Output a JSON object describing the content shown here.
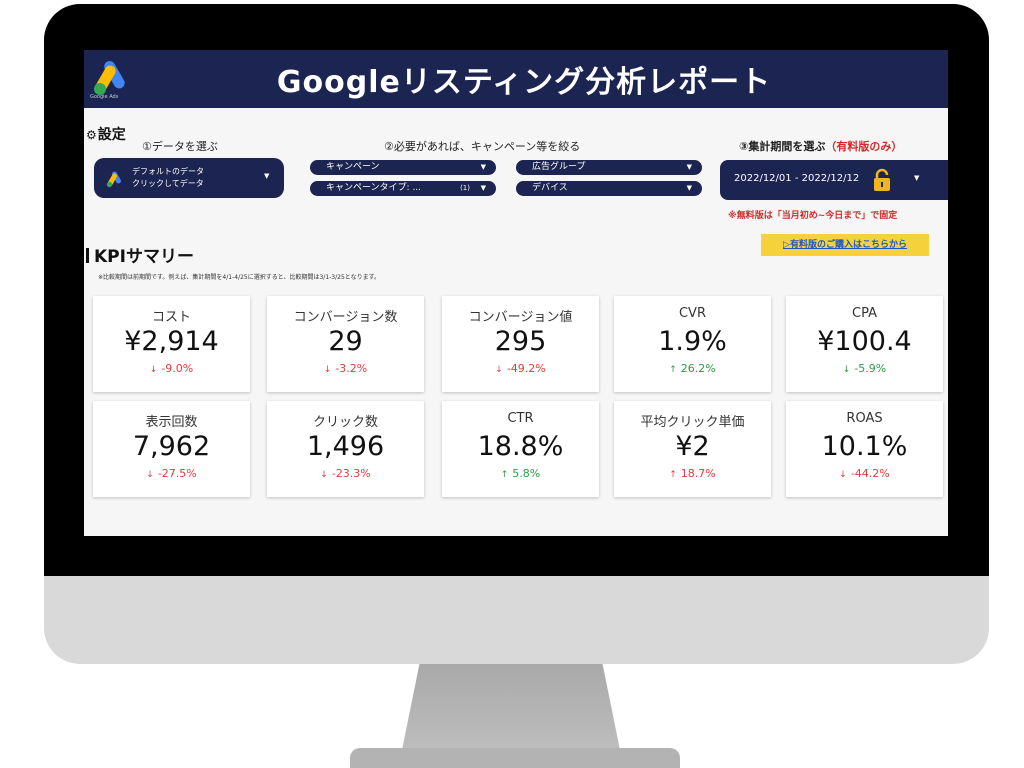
{
  "header": {
    "title": "Googleリスティング分析レポート",
    "logo_label": "Google Ads"
  },
  "settings": {
    "title": "設定",
    "step1": "①データを選ぶ",
    "step2": "②必要があれば、キャンペーン等を絞る",
    "step3_prefix": "③集計期間を選ぶ",
    "step3_suffix": "（有料版のみ）",
    "datasource_line1": "デフォルトのデータ",
    "datasource_line2": "クリックしてデータ",
    "filters": {
      "campaign": "キャンペーン",
      "ad_group": "広告グループ",
      "campaign_type": "キャンペーンタイプ: ...",
      "campaign_type_count": "(1)",
      "device": "デバイス"
    },
    "date_range": "2022/12/01 - 2022/12/12",
    "free_note": "※無料版は「当月初め~今日まで」で固定",
    "buy_link": "▷有料版のご購入はこちらから"
  },
  "kpi": {
    "title": "KPIサマリー",
    "note": "※比較期間は前期間です。例えば、集計期間を4/1-4/25に選択すると、比較期間は3/1-3/25となります。",
    "cards": [
      {
        "label": "コスト",
        "value": "¥2,914",
        "change": "-9.0%",
        "arrow": "↓",
        "trend": "neg"
      },
      {
        "label": "コンバージョン数",
        "value": "29",
        "change": "-3.2%",
        "arrow": "↓",
        "trend": "neg"
      },
      {
        "label": "コンバージョン値",
        "value": "295",
        "change": "-49.2%",
        "arrow": "↓",
        "trend": "neg"
      },
      {
        "label": "CVR",
        "value": "1.9%",
        "change": "26.2%",
        "arrow": "↑",
        "trend": "pos"
      },
      {
        "label": "CPA",
        "value": "¥100.4",
        "change": "-5.9%",
        "arrow": "↓",
        "trend": "pos"
      },
      {
        "label": "表示回数",
        "value": "7,962",
        "change": "-27.5%",
        "arrow": "↓",
        "trend": "neg"
      },
      {
        "label": "クリック数",
        "value": "1,496",
        "change": "-23.3%",
        "arrow": "↓",
        "trend": "neg"
      },
      {
        "label": "CTR",
        "value": "18.8%",
        "change": "5.8%",
        "arrow": "↑",
        "trend": "pos"
      },
      {
        "label": "平均クリック単価",
        "value": "¥2",
        "change": "18.7%",
        "arrow": "↑",
        "trend": "neg"
      },
      {
        "label": "ROAS",
        "value": "10.1%",
        "change": "-44.2%",
        "arrow": "↓",
        "trend": "neg"
      }
    ]
  },
  "colors": {
    "navy": "#1c2451",
    "negative": "#e23b3b",
    "positive": "#2e9b46",
    "buy_bg": "#f5d23c",
    "link": "#1a56c8"
  },
  "icons": [
    "google-ads-logo-icon",
    "gear-icon",
    "chevron-down-icon",
    "lock-icon",
    "arrow-down-icon",
    "arrow-up-icon"
  ]
}
